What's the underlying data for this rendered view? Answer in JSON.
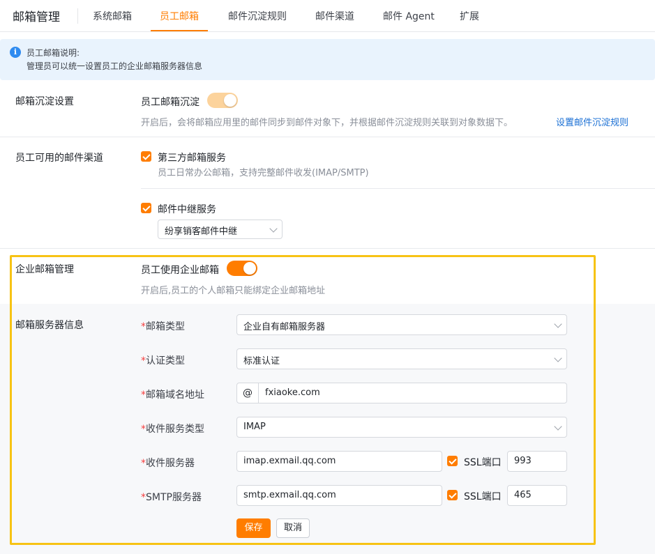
{
  "header": {
    "title": "邮箱管理",
    "tabs": [
      {
        "label": "系统邮箱"
      },
      {
        "label": "员工邮箱"
      },
      {
        "label": "邮件沉淀规则"
      },
      {
        "label": "邮件渠道"
      },
      {
        "label": "邮件 Agent"
      },
      {
        "label": "扩展"
      }
    ],
    "active_tab": "员工邮箱"
  },
  "info": {
    "title": "员工邮箱说明:",
    "body": "管理员可以统一设置员工的企业邮箱服务器信息"
  },
  "archive": {
    "section_label": "邮箱沉淀设置",
    "toggle_label": "员工邮箱沉淀",
    "toggle_on": true,
    "desc": "开启后，会将邮箱应用里的邮件同步到邮件对象下，并根据邮件沉淀规则关联到对象数据下。",
    "link": "设置邮件沉淀规则"
  },
  "channels": {
    "section_label": "员工可用的邮件渠道",
    "third_party": {
      "label": "第三方邮箱服务",
      "desc": "员工日常办公邮箱，支持完整邮件收发(IMAP/SMTP)",
      "checked": true
    },
    "relay": {
      "label": "邮件中继服务",
      "checked": true,
      "select_value": "纷享销客邮件中继"
    }
  },
  "enterprise": {
    "section_label": "企业邮箱管理",
    "toggle_label": "员工使用企业邮箱",
    "toggle_on": true,
    "desc": "开启后,员工的个人邮箱只能绑定企业邮箱地址"
  },
  "server": {
    "section_label": "邮箱服务器信息",
    "required_mark": "*",
    "fields": {
      "mailbox_type": {
        "label": "邮箱类型",
        "value": "企业自有邮箱服务器"
      },
      "auth_type": {
        "label": "认证类型",
        "value": "标准认证"
      },
      "domain": {
        "label": "邮箱域名地址",
        "prefix": "@",
        "value": "fxiaoke.com"
      },
      "incoming_type": {
        "label": "收件服务类型",
        "value": "IMAP"
      },
      "incoming_server": {
        "label": "收件服务器",
        "value": "imap.exmail.qq.com",
        "ssl_label": "SSL端口",
        "ssl_checked": true,
        "port": "993"
      },
      "smtp_server": {
        "label": "SMTP服务器",
        "value": "smtp.exmail.qq.com",
        "ssl_label": "SSL端口",
        "ssl_checked": true,
        "port": "465"
      }
    },
    "save_label": "保存",
    "cancel_label": "取消"
  },
  "colors": {
    "accent": "#ff7d00",
    "highlight_border": "#f7c314",
    "link": "#1a6fd4",
    "info_bg": "#e9f3fd"
  }
}
